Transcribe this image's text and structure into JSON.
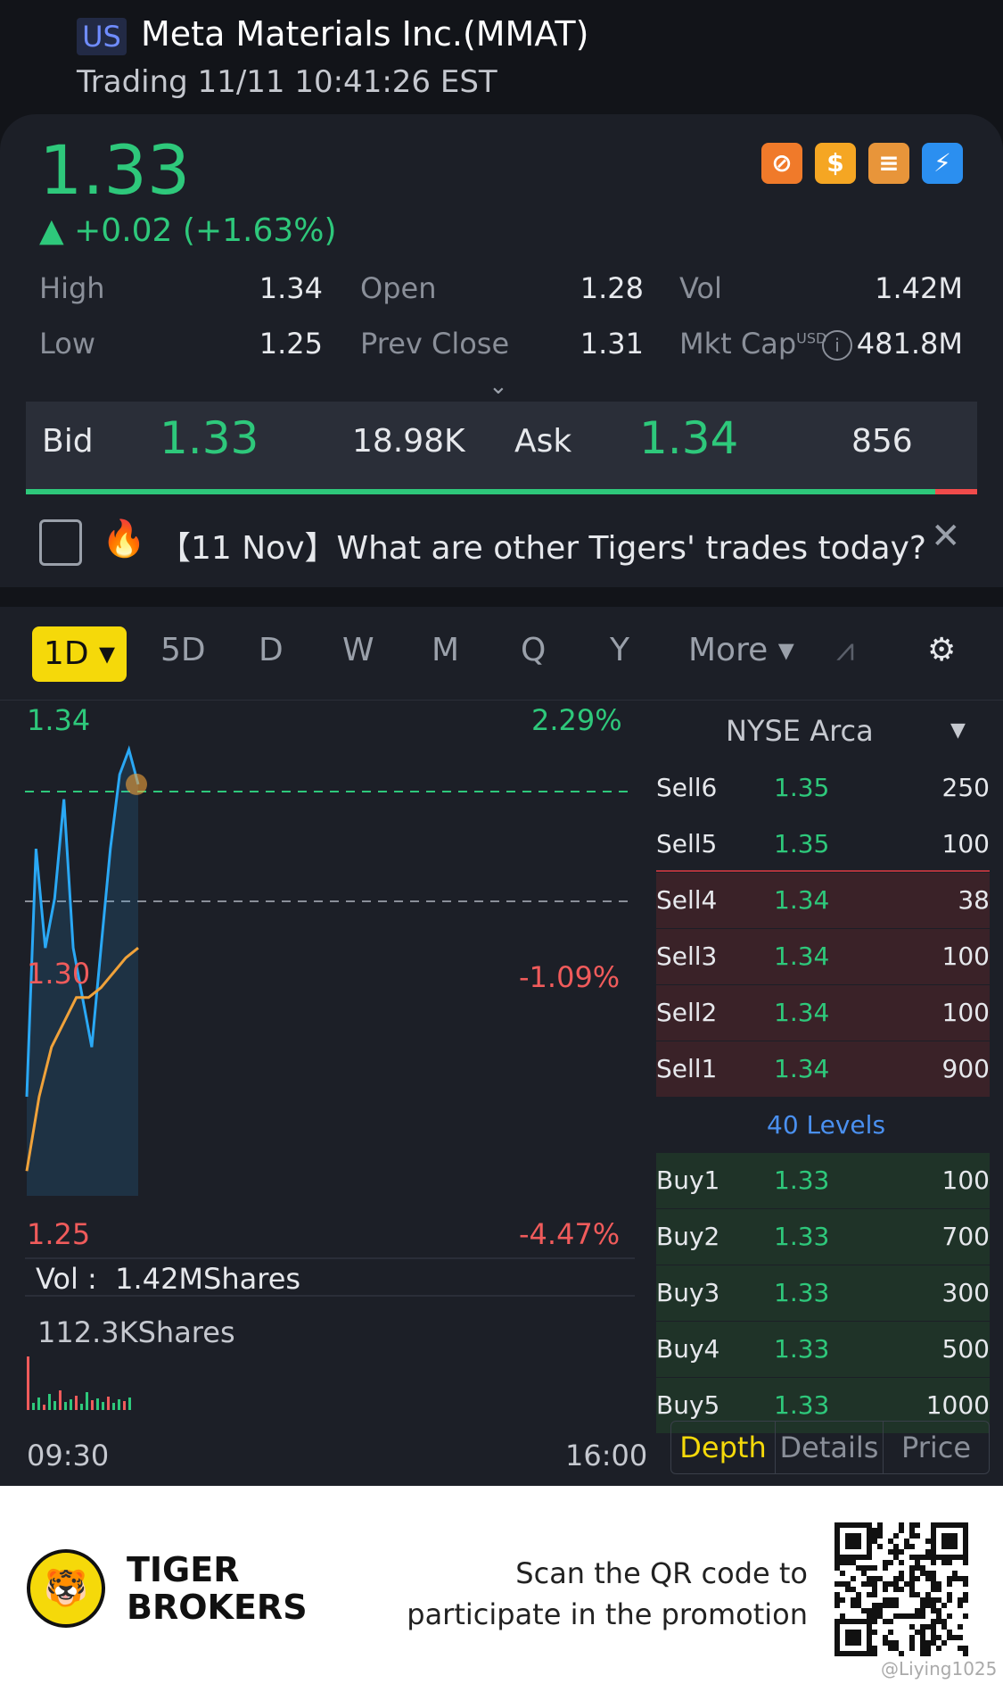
{
  "header": {
    "market_badge": "US",
    "title": "Meta Materials Inc.(MMAT)",
    "subtitle": "Trading 11/11 10:41:26 EST"
  },
  "quote": {
    "price": "1.33",
    "change": "▲ +0.02 (+1.63%)",
    "stats": {
      "high_label": "High",
      "high": "1.34",
      "low_label": "Low",
      "low": "1.25",
      "open_label": "Open",
      "open": "1.28",
      "prev_close_label": "Prev Close",
      "prev_close": "1.31",
      "vol_label": "Vol",
      "vol": "1.42M",
      "mkt_cap_label": "Mkt Cap",
      "mkt_cap_unit": "USD",
      "mkt_cap": "481.8M"
    },
    "bid_label": "Bid",
    "bid": "1.33",
    "bid_size": "18.98K",
    "ask_label": "Ask",
    "ask": "1.34",
    "ask_size": "856",
    "bid_ratio": 0.956
  },
  "news": {
    "text": "【11 Nov】What are other Tigers' trades today?"
  },
  "tabs": {
    "active": "1D",
    "items": [
      "5D",
      "D",
      "W",
      "M",
      "Q",
      "Y",
      "More"
    ]
  },
  "chart": {
    "y_top": "1.34",
    "y_top_pct": "2.29%",
    "y_mid": "1.30",
    "y_mid_pct": "-1.09%",
    "y_bottom": "1.25",
    "y_bottom_pct": "-4.47%",
    "vol_label": "Vol :",
    "vol_value": "1.42MShares",
    "vol_max": "112.3KShares",
    "x_start": "09:30",
    "x_end": "16:00"
  },
  "chart_data": {
    "type": "line",
    "series": [
      {
        "values": [
          1.27,
          1.32,
          1.3,
          1.31,
          1.33,
          1.3,
          1.29,
          1.28,
          1.3,
          1.32,
          1.335,
          1.34,
          1.333
        ]
      },
      {
        "values": [
          1.255,
          1.27,
          1.28,
          1.285,
          1.29,
          1.29,
          1.292,
          1.295,
          1.298,
          1.3
        ]
      }
    ],
    "ylim": [
      1.25,
      1.34
    ],
    "xlim": [
      "09:30",
      "16:00"
    ],
    "prev_close": 1.31,
    "current": 1.333,
    "colors": {
      "price": "#2aa8f5",
      "avg": "#f0a23a",
      "up": "#2ec87b",
      "down": "#f05b5b"
    }
  },
  "orderbook": {
    "exchange": "NYSE Arca",
    "levels_label": "40 Levels",
    "sells": [
      {
        "label": "Sell6",
        "price": "1.35",
        "qty": "250"
      },
      {
        "label": "Sell5",
        "price": "1.35",
        "qty": "100"
      },
      {
        "label": "Sell4",
        "price": "1.34",
        "qty": "38"
      },
      {
        "label": "Sell3",
        "price": "1.34",
        "qty": "100"
      },
      {
        "label": "Sell2",
        "price": "1.34",
        "qty": "100"
      },
      {
        "label": "Sell1",
        "price": "1.34",
        "qty": "900"
      }
    ],
    "buys": [
      {
        "label": "Buy1",
        "price": "1.33",
        "qty": "100"
      },
      {
        "label": "Buy2",
        "price": "1.33",
        "qty": "700"
      },
      {
        "label": "Buy3",
        "price": "1.33",
        "qty": "300"
      },
      {
        "label": "Buy4",
        "price": "1.33",
        "qty": "500"
      },
      {
        "label": "Buy5",
        "price": "1.33",
        "qty": "1000"
      }
    ],
    "tabs": [
      "Depth",
      "Details",
      "Price"
    ]
  },
  "footer": {
    "brand_line1": "TIGER",
    "brand_line2": "BROKERS",
    "promo_line1": "Scan the QR code to",
    "promo_line2": "participate in the promotion",
    "watermark": "@Liying1025"
  }
}
